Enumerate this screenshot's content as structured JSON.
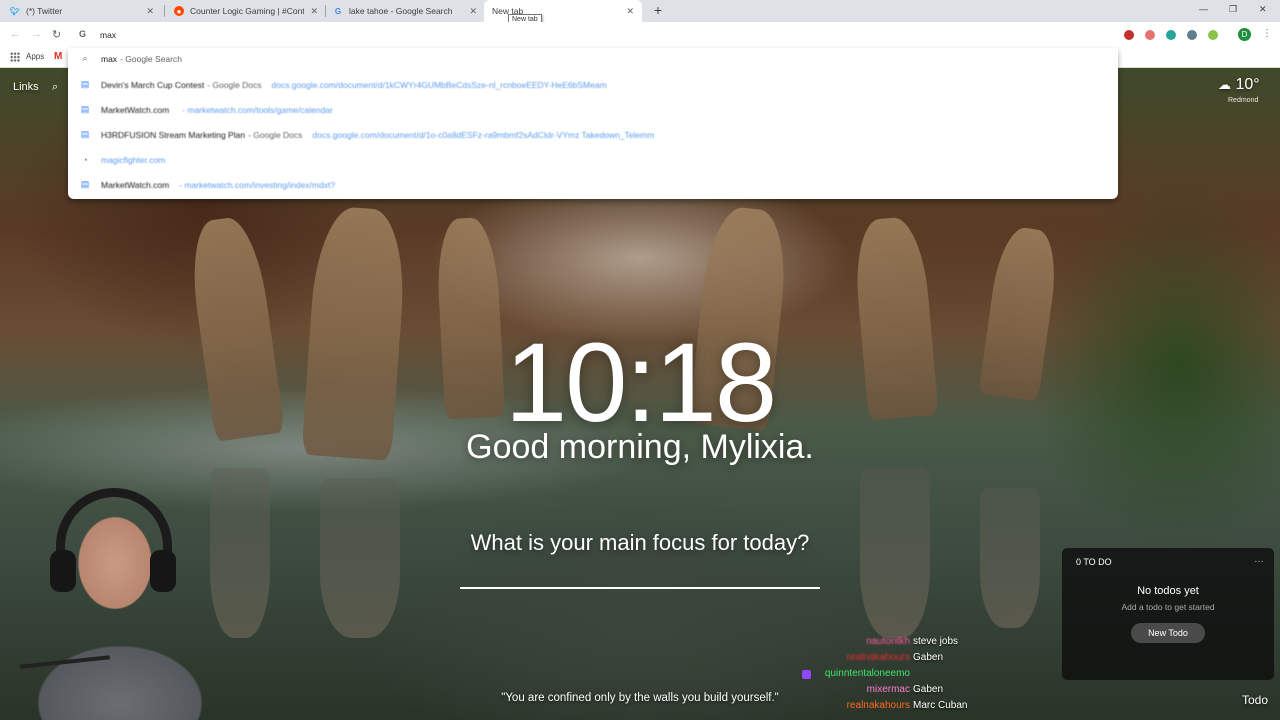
{
  "tabs": [
    {
      "title": "(*) Twitter",
      "favicon": "twitter-bird-icon",
      "color": "#1da1f2"
    },
    {
      "title": "Counter Logic Gaming | #Conte",
      "favicon": "reddit-icon",
      "color": "#ff4500"
    },
    {
      "title": "lake tahoe - Google Search",
      "favicon": "google-g-icon",
      "color": "#4285f4"
    },
    {
      "title": "New tab",
      "favicon": "",
      "color": "#5f6368"
    }
  ],
  "tooltip": "New tab",
  "omnibox": {
    "value": "max",
    "prefix": "G"
  },
  "bookmarks": {
    "apps_label": "Apps",
    "gmail_glyph": "M"
  },
  "suggestions": [
    {
      "icon": "search-icon",
      "title": "max",
      "sub": "- Google Search",
      "url": ""
    },
    {
      "icon": "docs-icon",
      "title": "Devin's March Cup Contest",
      "sub": "- Google Docs",
      "url": "docs.google.com/document/d/1kCWYr4GUMbBeCdsSze-nl_rcnboeEEDY-HeE6bSMeam"
    },
    {
      "icon": "docs-icon",
      "title": "MarketWatch.com",
      "sub": "",
      "url": "- marketwatch.com/tools/game/calendar"
    },
    {
      "icon": "docs-icon",
      "title": "H3RDFUSION Stream Marketing Plan",
      "sub": "- Google Docs",
      "url": "docs.google.com/document/d/1o-c0a8dESFz-ra9mbmf2sAdCIdr-VYmz Takedown_Telemm"
    },
    {
      "icon": "history-icon",
      "title": "magicfighter.com",
      "sub": "",
      "url": ""
    },
    {
      "icon": "docs-icon",
      "title": "MarketWatch.com",
      "sub": "",
      "url": "- marketwatch.com/investing/index/mdxt?"
    }
  ],
  "momentum": {
    "links_label": "Links",
    "weather_temp": "10°",
    "weather_location": "Redmond",
    "clock": "10:18",
    "greeting": "Good morning, Mylixia.",
    "focus_question": "What is your main focus for today?",
    "quote": "\"You are confined only by the walls you build yourself.\"",
    "todo_link": "Todo"
  },
  "todo_panel": {
    "header": "0 TO DO",
    "empty_title": "No todos yet",
    "empty_hint": "Add a todo to get started",
    "new_button": "New Todo"
  },
  "chat": [
    {
      "user": "nautontkh",
      "msg": "steve jobs",
      "color": "#ff5aa0",
      "badge": false
    },
    {
      "user": "realnakahours",
      "msg": "Gaben",
      "color": "#e03030",
      "badge": false
    },
    {
      "user": "quinntentaloneemo",
      "msg": "",
      "color": "#3ee36b",
      "badge": true
    },
    {
      "user": "mixermac",
      "msg": "Gaben",
      "color": "#ff7ad1",
      "badge": false
    },
    {
      "user": "realnakahours",
      "msg": "Marc Cuban",
      "color": "#ff6a1a",
      "badge": false
    }
  ],
  "colors": {
    "twitter": "#1da1f2",
    "reddit": "#ff4500",
    "docs_blue": "#4285f4",
    "profile_green": "#1e8e3e"
  }
}
